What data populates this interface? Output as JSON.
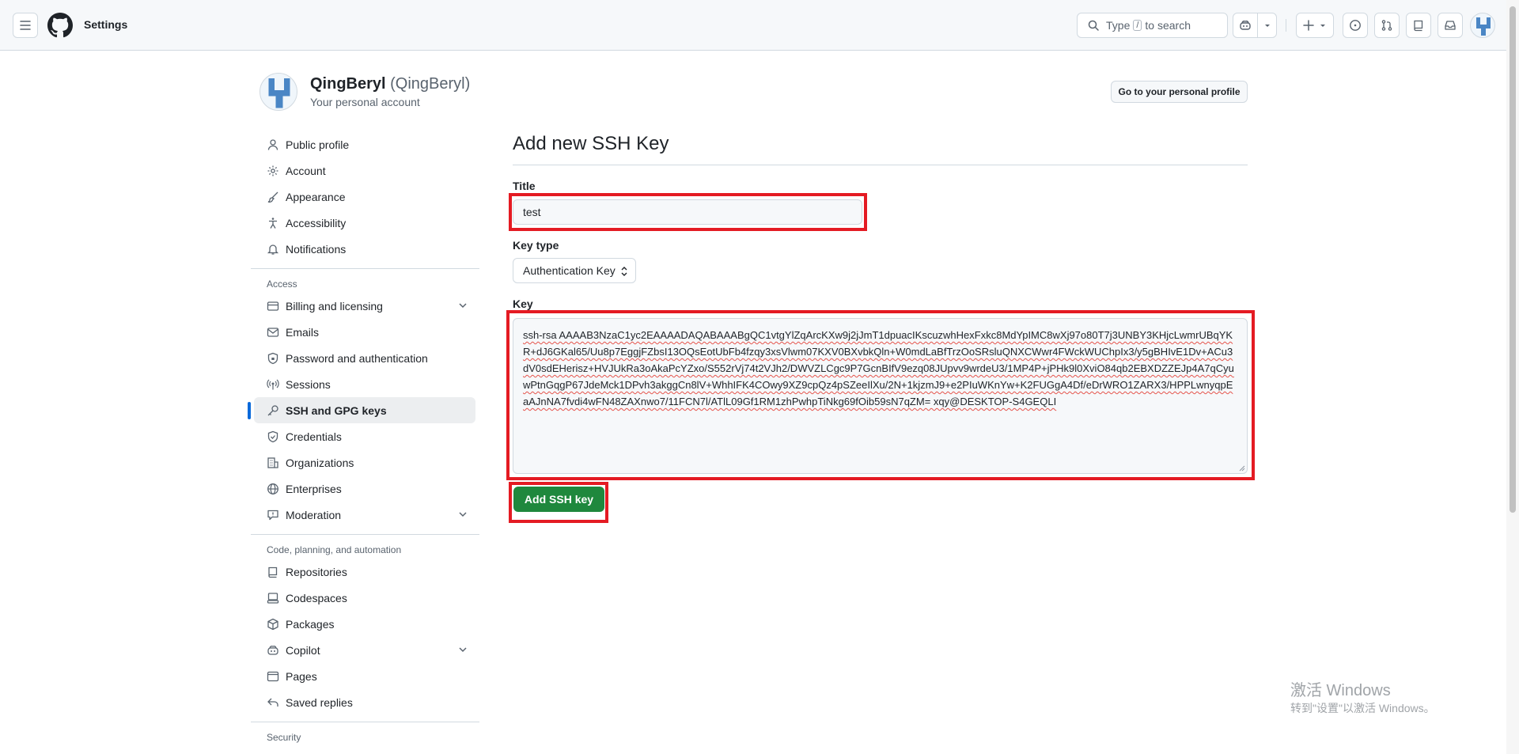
{
  "header": {
    "context_title": "Settings",
    "search_prefix": "Type",
    "search_key": "/",
    "search_suffix": "to search"
  },
  "account": {
    "name": "QingBeryl",
    "login": "(QingBeryl)",
    "subtitle": "Your personal account",
    "profile_button": "Go to your personal profile"
  },
  "sidebar": {
    "items_top": [
      {
        "label": "Public profile",
        "icon": "person-icon"
      },
      {
        "label": "Account",
        "icon": "gear-icon"
      },
      {
        "label": "Appearance",
        "icon": "paintbrush-icon"
      },
      {
        "label": "Accessibility",
        "icon": "accessibility-icon"
      },
      {
        "label": "Notifications",
        "icon": "bell-icon"
      }
    ],
    "access_title": "Access",
    "items_access": [
      {
        "label": "Billing and licensing",
        "icon": "credit-card-icon"
      },
      {
        "label": "Emails",
        "icon": "mail-icon"
      },
      {
        "label": "Password and authentication",
        "icon": "shield-lock-icon"
      },
      {
        "label": "Sessions",
        "icon": "broadcast-icon"
      },
      {
        "label": "SSH and GPG keys",
        "icon": "key-icon"
      },
      {
        "label": "Credentials",
        "icon": "shield-check-icon"
      },
      {
        "label": "Organizations",
        "icon": "organization-icon"
      },
      {
        "label": "Enterprises",
        "icon": "globe-icon"
      },
      {
        "label": "Moderation",
        "icon": "report-icon"
      }
    ],
    "code_title": "Code, planning, and automation",
    "items_code": [
      {
        "label": "Repositories",
        "icon": "repo-icon"
      },
      {
        "label": "Codespaces",
        "icon": "codespaces-icon"
      },
      {
        "label": "Packages",
        "icon": "package-icon"
      },
      {
        "label": "Copilot",
        "icon": "copilot-icon"
      },
      {
        "label": "Pages",
        "icon": "browser-icon"
      },
      {
        "label": "Saved replies",
        "icon": "reply-icon"
      }
    ],
    "security_title": "Security"
  },
  "main": {
    "title": "Add new SSH Key",
    "title_label": "Title",
    "title_value": "test",
    "key_type_label": "Key type",
    "key_type_value": "Authentication Key",
    "key_label": "Key",
    "key_value": "ssh-rsa AAAAB3NzaC1yc2EAAAADAQABAAABgQC1vtgYlZqArcKXw9j2jJmT1dpuacIKscuzwhHexFxkc8MdYpIMC8wXj97o80T7j3UNBY3KHjcLwmrUBqYKR+dJ6GKal65/Uu8p7EggjFZbsI13OQsEotUbFb4fzqy3xsVlwm07KXV0BXvbkQln+W0mdLaBfTrzOoSRsluQNXCWwr4FWckWUChpIx3/y5gBHIvE1Dv+ACu3dV0sdEHerisz+HVJUkRa3oAkaPcYZxo/S552rVj74t2VJh2/DWVZLCgc9P7GcnBIfV9ezq08JUpvv9wrdeU3/1MP4P+jPHk9l0XviO84qb2EBXDZZEJp4A7qCyuwPtnGqgP67JdeMck1DPvh3akggCn8lV+WhhIFK4COwy9XZ9cpQz4pSZeeIlXu/2N+1kjzmJ9+e2PIuWKnYw+K2FUGgA4Df/eDrWRO1ZARX3/HPPLwnyqpEaAJnNA7fvdi4wFN48ZAXnwo7/11FCN7l/ATlL09Gf1RM1zhPwhpTiNkg69fOib59sN7qZM= xqy@DESKTOP-S4GEQLI",
    "submit_button": "Add SSH key"
  },
  "watermark": {
    "line1": "激活 Windows",
    "line2": "转到\"设置\"以激活 Windows。"
  }
}
